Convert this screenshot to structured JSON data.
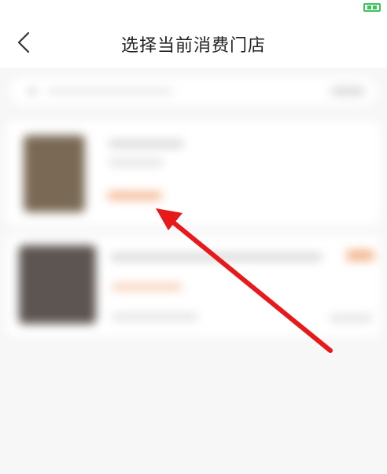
{
  "status_bar": {
    "battery_icon": "battery-icon"
  },
  "header": {
    "back_icon": "chevron-left-icon",
    "title": "选择当前消费门店"
  },
  "annotation": {
    "arrow_color": "#e8191a",
    "arrow_icon": "red-arrow-icon"
  }
}
